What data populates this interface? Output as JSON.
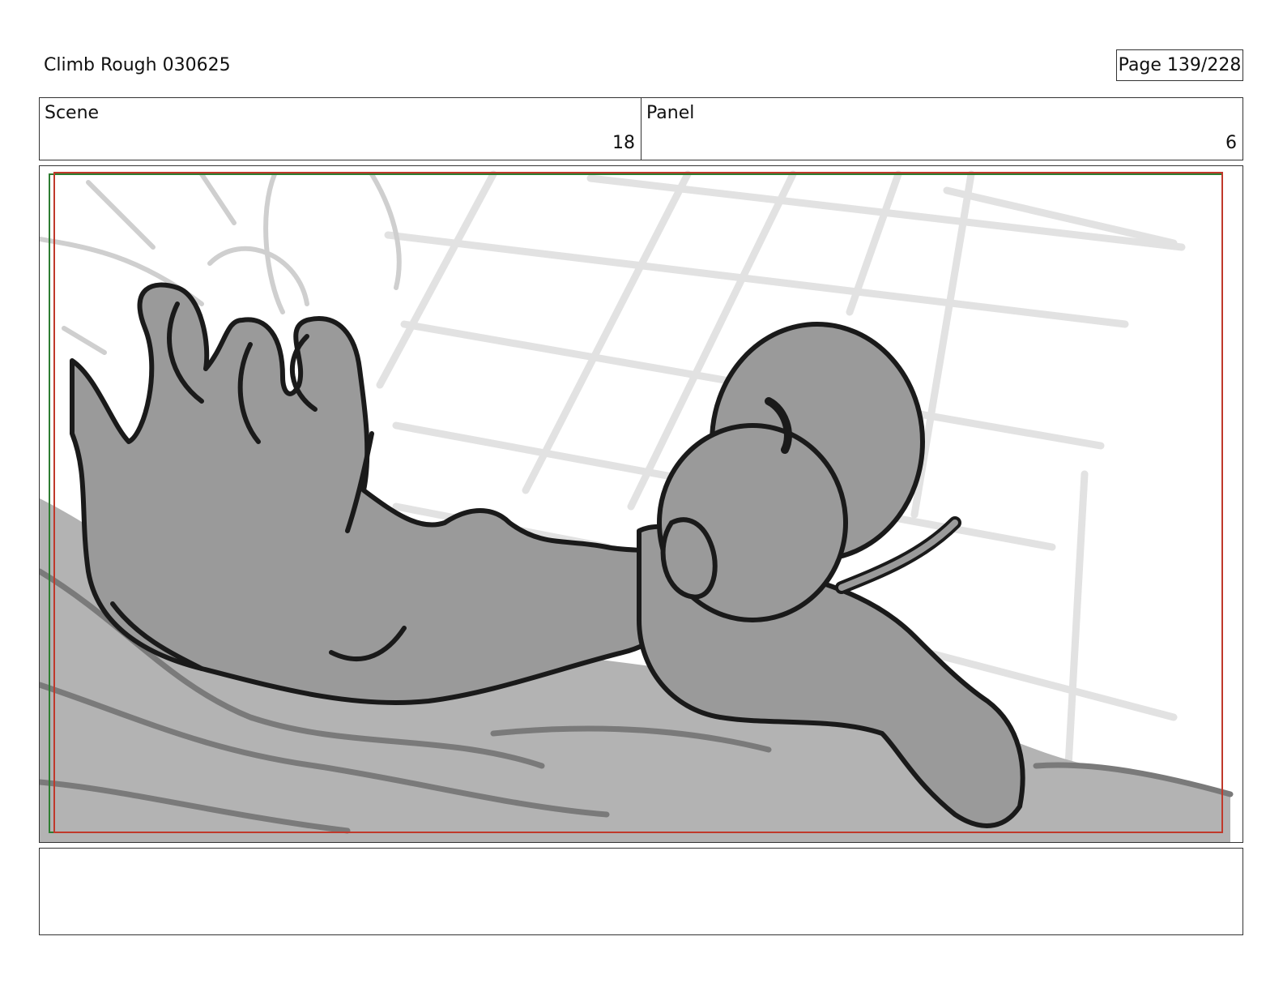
{
  "document": {
    "title": "Climb Rough 030625",
    "page_label": "Page 139/228"
  },
  "info": {
    "scene_label": "Scene",
    "scene_value": "18",
    "panel_label": "Panel",
    "panel_value": "6"
  },
  "artwork": {
    "description_icon": "storyboard-sketch",
    "colors": {
      "safe_frame_red": "#c0392b",
      "safe_frame_green": "#2e7d32",
      "character_fill": "#9a9a9a",
      "rock_fill": "#b3b3b3",
      "wall_grid": "#e2e2e2",
      "ink": "#1a1a1a"
    }
  },
  "notes": {
    "text": ""
  }
}
